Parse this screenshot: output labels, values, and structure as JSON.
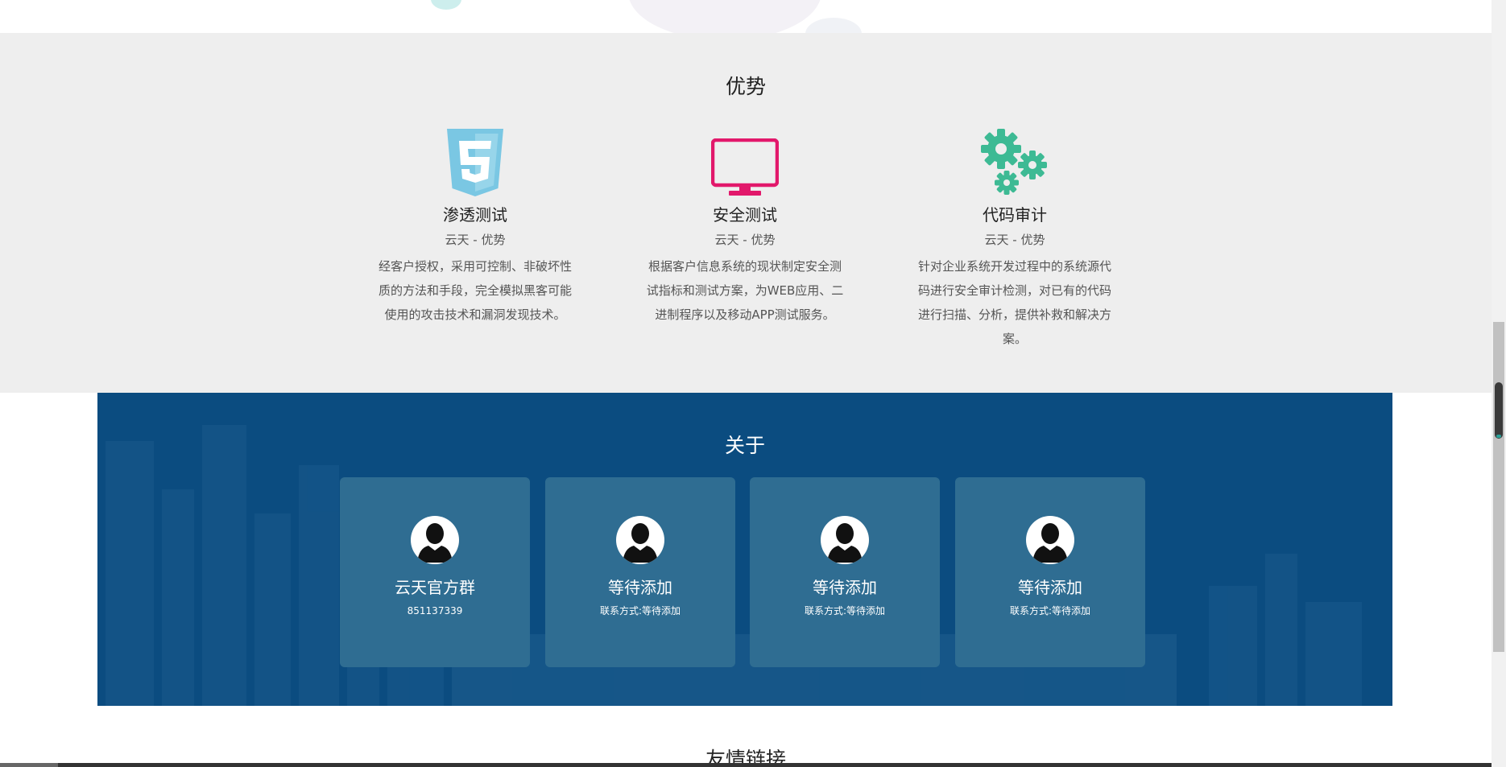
{
  "advantages": {
    "title": "优势",
    "items": [
      {
        "icon": "html5-icon",
        "color": "#7ac7e3",
        "name": "渗透测试",
        "subtitle": "云天 - 优势",
        "description": "经客户授权，采用可控制、非破坏性质的方法和手段，完全模拟黑客可能使用的攻击技术和漏洞发现技术。"
      },
      {
        "icon": "monitor-icon",
        "color": "#e2186b",
        "name": "安全测试",
        "subtitle": "云天 - 优势",
        "description": "根据客户信息系统的现状制定安全测试指标和测试方案，为WEB应用、二进制程序以及移动APP测试服务。"
      },
      {
        "icon": "gears-icon",
        "color": "#3dba94",
        "name": "代码审计",
        "subtitle": "云天 - 优势",
        "description": "针对企业系统开发过程中的系统源代码进行安全审计检测，对已有的代码进行扫描、分析，提供补救和解决方案。"
      }
    ]
  },
  "about": {
    "title": "关于",
    "background_color": "#0b4c80",
    "card_color": "#2f6d92",
    "cards": [
      {
        "icon": "user-avatar-icon",
        "name": "云天官方群",
        "contact": "851137339"
      },
      {
        "icon": "user-avatar-icon",
        "name": "等待添加",
        "contact": "联系方式:等待添加"
      },
      {
        "icon": "user-avatar-icon",
        "name": "等待添加",
        "contact": "联系方式:等待添加"
      },
      {
        "icon": "user-avatar-icon",
        "name": "等待添加",
        "contact": "联系方式:等待添加"
      }
    ]
  },
  "links": {
    "title": "友情链接"
  }
}
